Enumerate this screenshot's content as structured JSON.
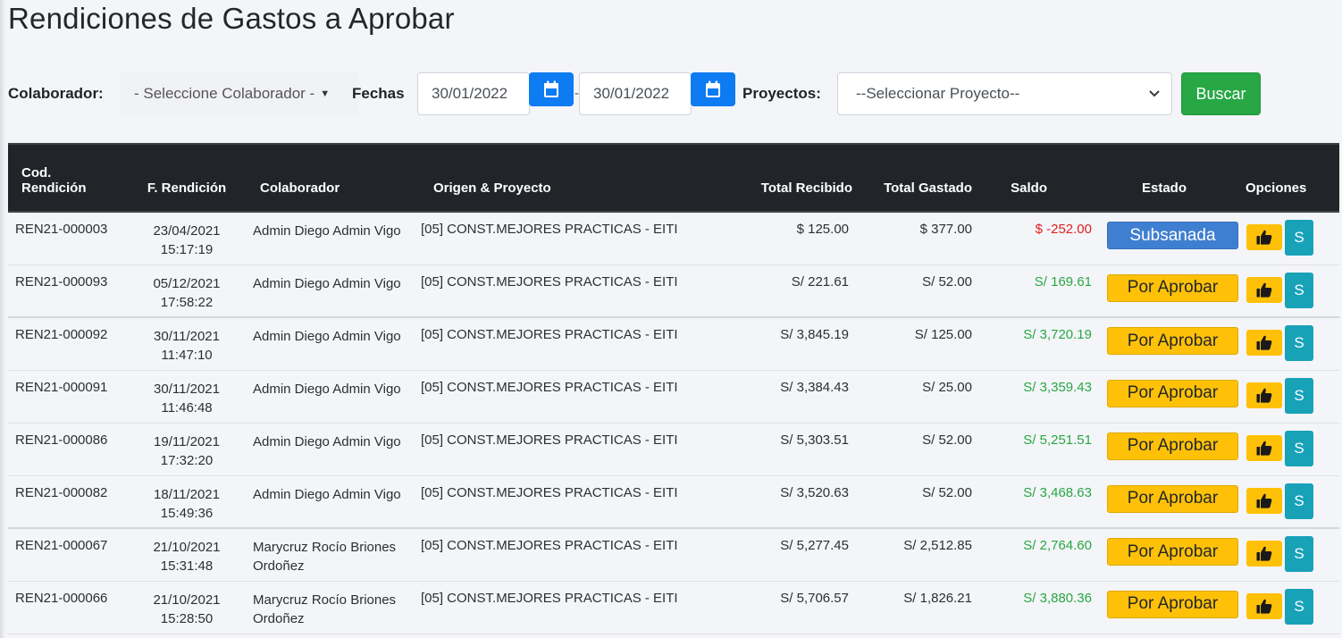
{
  "page": {
    "title": "Rendiciones de Gastos a Aprobar"
  },
  "filters": {
    "colaborador_label": "Colaborador:",
    "colaborador_value": "- Seleccione Colaborador -",
    "fechas_label": "Fechas",
    "fecha_desde": "30/01/2022",
    "fecha_separator": "-",
    "fecha_hasta": "30/01/2022",
    "proyectos_label": "Proyectos:",
    "proyecto_value": "--Seleccionar Proyecto--",
    "buscar_label": "Buscar",
    "icons": {
      "calendar": "calendar-icon",
      "dropdown": "chevron-down-icon"
    },
    "colors": {
      "calendar_button": "#0d7bf2",
      "buscar_button": "#28a745"
    }
  },
  "table": {
    "headers": {
      "cod_line1": "Cod.",
      "cod_line2": "Rendición",
      "fecha": "F. Rendición",
      "colaborador": "Colaborador",
      "origen": "Origen & Proyecto",
      "total_recibido": "Total Recibido",
      "total_gastado": "Total Gastado",
      "saldo": "Saldo",
      "estado": "Estado",
      "opciones": "Opciones"
    },
    "rows": [
      {
        "cod": "REN21-000003",
        "fecha": "23/04/2021",
        "hora": "15:17:19",
        "colab1": "Admin Diego Admin Vigo",
        "colab2": "",
        "origen": "[05] CONST.MEJORES PRACTICAS - EITI",
        "recibido": "$ 125.00",
        "gastado": "$ 377.00",
        "saldo": "$ -252.00",
        "saldo_sign": "neg",
        "estado": "Subsanada",
        "estado_color": "blue",
        "s_label": "S"
      },
      {
        "cod": "REN21-000093",
        "fecha": "05/12/2021",
        "hora": "17:58:22",
        "colab1": "Admin Diego Admin Vigo",
        "colab2": "",
        "origen": "[05] CONST.MEJORES PRACTICAS - EITI",
        "recibido": "S/ 221.61",
        "gastado": "S/ 52.00",
        "saldo": "S/ 169.61",
        "saldo_sign": "pos",
        "estado": "Por Aprobar",
        "estado_color": "yellow",
        "s_label": "S"
      },
      {
        "cod": "REN21-000092",
        "fecha": "30/11/2021",
        "hora": "11:47:10",
        "colab1": "Admin Diego Admin Vigo",
        "colab2": "",
        "origen": "[05] CONST.MEJORES PRACTICAS - EITI",
        "recibido": "S/ 3,845.19",
        "gastado": "S/ 125.00",
        "saldo": "S/ 3,720.19",
        "saldo_sign": "pos",
        "estado": "Por Aprobar",
        "estado_color": "yellow",
        "s_label": "S"
      },
      {
        "cod": "REN21-000091",
        "fecha": "30/11/2021",
        "hora": "11:46:48",
        "colab1": "Admin Diego Admin Vigo",
        "colab2": "",
        "origen": "[05] CONST.MEJORES PRACTICAS - EITI",
        "recibido": "S/ 3,384.43",
        "gastado": "S/ 25.00",
        "saldo": "S/ 3,359.43",
        "saldo_sign": "pos",
        "estado": "Por Aprobar",
        "estado_color": "yellow",
        "s_label": "S"
      },
      {
        "cod": "REN21-000086",
        "fecha": "19/11/2021",
        "hora": "17:32:20",
        "colab1": "Admin Diego Admin Vigo",
        "colab2": "",
        "origen": "[05] CONST.MEJORES PRACTICAS - EITI",
        "recibido": "S/ 5,303.51",
        "gastado": "S/ 52.00",
        "saldo": "S/ 5,251.51",
        "saldo_sign": "pos",
        "estado": "Por Aprobar",
        "estado_color": "yellow",
        "s_label": "S"
      },
      {
        "cod": "REN21-000082",
        "fecha": "18/11/2021",
        "hora": "15:49:36",
        "colab1": "Admin Diego Admin Vigo",
        "colab2": "",
        "origen": "[05] CONST.MEJORES PRACTICAS - EITI",
        "recibido": "S/ 3,520.63",
        "gastado": "S/ 52.00",
        "saldo": "S/ 3,468.63",
        "saldo_sign": "pos",
        "estado": "Por Aprobar",
        "estado_color": "yellow",
        "s_label": "S"
      },
      {
        "cod": "REN21-000067",
        "fecha": "21/10/2021",
        "hora": "15:31:48",
        "colab1": "Marycruz Rocío Briones",
        "colab2": "Ordoñez",
        "origen": "[05] CONST.MEJORES PRACTICAS - EITI",
        "recibido": "S/ 5,277.45",
        "gastado": "S/ 2,512.85",
        "saldo": "S/ 2,764.60",
        "saldo_sign": "pos",
        "estado": "Por Aprobar",
        "estado_color": "yellow",
        "s_label": "S"
      },
      {
        "cod": "REN21-000066",
        "fecha": "21/10/2021",
        "hora": "15:28:50",
        "colab1": "Marycruz Rocío Briones",
        "colab2": "Ordoñez",
        "origen": "[05] CONST.MEJORES PRACTICAS - EITI",
        "recibido": "S/ 5,706.57",
        "gastado": "S/ 1,826.21",
        "saldo": "S/ 3,880.36",
        "saldo_sign": "pos",
        "estado": "Por Aprobar",
        "estado_color": "yellow",
        "s_label": "S"
      }
    ],
    "colors": {
      "header_bg": "#212529",
      "saldo_negative": "#e02020",
      "saldo_positive": "#28a745",
      "estado_blue": "#3f7fd1",
      "estado_yellow": "#ffc107",
      "s_button": "#17a2b8"
    },
    "icons": {
      "approve": "thumbs-up-icon"
    }
  }
}
